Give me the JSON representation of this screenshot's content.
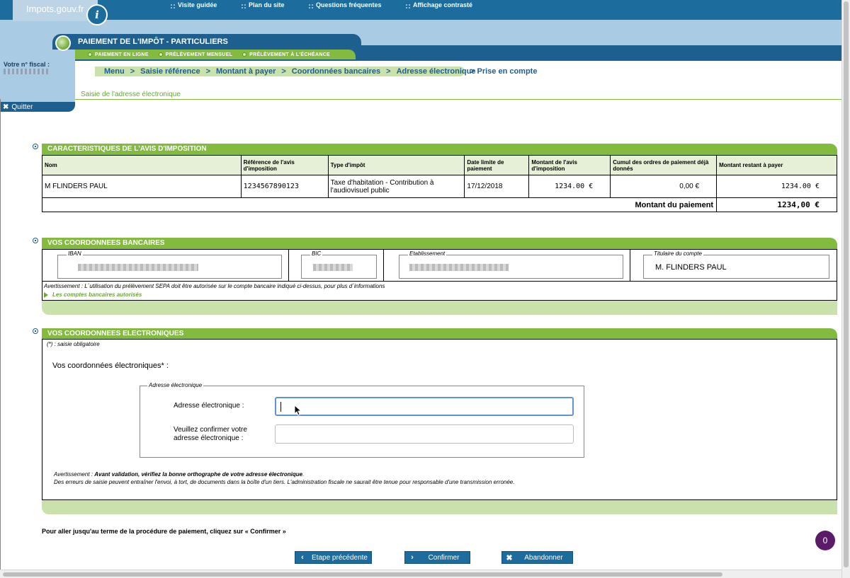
{
  "header": {
    "logo_text": "Impots.gouv.fr",
    "logo_letter": "i",
    "top_links": [
      "Visite guidée",
      "Plan du site",
      "Questions fréquentes",
      "Affichage contrasté"
    ]
  },
  "left_panel": {
    "fiscal_label": "Votre n° fiscal :",
    "quit_label": "Quitter"
  },
  "app": {
    "title": "PAIEMENT DE L'IMPÔT - PARTICULIERS",
    "subtabs": [
      "PAIEMENT EN LIGNE",
      "PRÉLÈVEMENT MENSUEL",
      "PRÉLÈVEMENT À L'ÉCHÉANCE"
    ]
  },
  "breadcrumb": {
    "items": [
      "Menu",
      "Saisie référence",
      "Montant à payer",
      "Coordonnées bancaires",
      "Adresse électronique"
    ],
    "separator": ">",
    "last": "> Prise en compte"
  },
  "page_subtitle": "Saisie de l'adresse électronique",
  "avis": {
    "heading": "CARACTERISTIQUES DE L'AVIS D'IMPOSITION",
    "columns": [
      "Nom",
      "Référence de l'avis d'imposition",
      "Type d'impôt",
      "Date limite de paiement",
      "Montant de l'avis d'imposition",
      "Cumul des ordres de paiement déjà donnés",
      "Montant restant à payer"
    ],
    "row": [
      "M FLINDERS PAUL",
      "1234567890123",
      "Taxe d'habitation - Contribution à l'audiovisuel public",
      "17/12/2018",
      "1234.00 €",
      "0,00 €",
      "1234.00 €"
    ],
    "total_label": "Montant du paiement",
    "total_value": "1234,00 €"
  },
  "bank": {
    "heading": "VOS COORDONNEES BANCAIRES",
    "iban_label": "IBAN",
    "bic_label": "BIC",
    "etab_label": "Etablissement",
    "holder_label": "Titulaire du compte",
    "holder_value": "M. FLINDERS PAUL",
    "warning": "Avertissement :   L´utilisation du prélèvement SEPA doit être autorisée sur le compte bancaire indiqué ci-dessus, pour plus d´informations",
    "link": "Les comptes bancaires autorisés"
  },
  "elec": {
    "heading": "VOS COORDONNEES ELECTRONIQUES",
    "mandatory": "(*) : saisie obligatoire",
    "label": "Vos coordonnées électroniques*  :",
    "fieldset_legend": "Adresse électronique",
    "email_label": "Adresse électronique :",
    "confirm_label_1": "Veuillez confirmer votre",
    "confirm_label_2": "adresse électronique :",
    "email_value": "",
    "confirm_value": "",
    "warn_prefix": "Avertissement : ",
    "warn_bold": "Avant validation, vérifiez la bonne orthographe de votre adresse électronique",
    "warn_end": ".",
    "warn_line2": "Des erreurs de saisie peuvent entraîner l'envoi, à tort, de documents dans la boîte d'un tiers. L'administration fiscale ne saurait être tenue pour responsable d'une transmission erronée."
  },
  "instruction": "Pour aller jusqu'au terme de la procédure de paiement, cliquez sur « Confirmer »",
  "buttons": {
    "prev": "Etape précédente",
    "confirm": "Confirmer",
    "abandon": "Abandonner"
  },
  "badge": "0",
  "colors": {
    "primary_blue": "#1d6c9e",
    "accent_green": "#83bb3f",
    "light_green": "#c9e1aa"
  }
}
